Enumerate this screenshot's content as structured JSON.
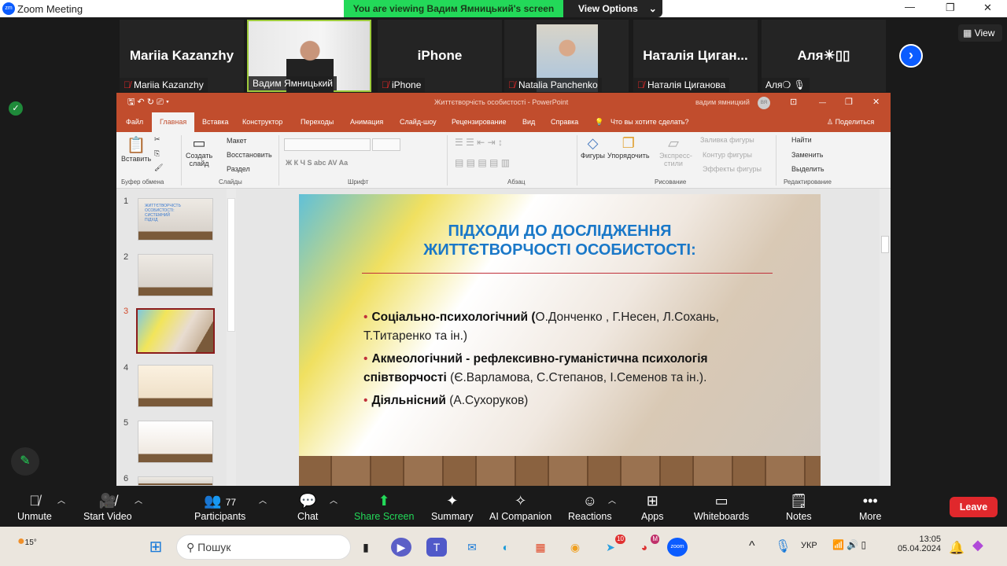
{
  "window": {
    "title": "Zoom Meeting",
    "logo": "zm"
  },
  "banner": {
    "text": "You are viewing Вадим Ямницький's screen",
    "view_options": "View Options"
  },
  "participants": [
    {
      "display": "Mariia Kazanzhy",
      "label": "Mariia Kazanzhy",
      "muted": true
    },
    {
      "display": "",
      "label": "Вадим Ямницький",
      "muted": false,
      "video": true
    },
    {
      "display": "iPhone",
      "label": "iPhone",
      "muted": true
    },
    {
      "display": "",
      "label": "Natalia Panchenko",
      "muted": true,
      "video": true
    },
    {
      "display": "Наталія  Циган...",
      "label": "Наталія Циганова",
      "muted": true
    },
    {
      "display": "Аля☀▯▯",
      "label": "Аля❍ 🎙",
      "muted": false
    }
  ],
  "view_button": "View",
  "ppt": {
    "title": "Життєтворчість особистості  -  PowerPoint",
    "user": "вадим ямницкий",
    "avatar": "ВЯ",
    "tabs": [
      "Файл",
      "Главная",
      "Вставка",
      "Конструктор",
      "Переходы",
      "Анимация",
      "Слайд-шоу",
      "Рецензирование",
      "Вид",
      "Справка"
    ],
    "active_tab": "Главная",
    "tell_me": "Что вы хотите сделать?",
    "share": "Поделиться",
    "ribbon": {
      "paste": "Вставить",
      "new_slide": "Создать слайд",
      "layout": "Макет",
      "reset": "Восстановить",
      "section": "Раздел",
      "shapes": "Фигуры",
      "arrange": "Упорядочить",
      "quick_styles": "Экспресс-стили",
      "fill": "Заливка фигуры",
      "outline": "Контур фигуры",
      "effects": "Эффекты фигуры",
      "find": "Найти",
      "replace": "Заменить",
      "select": "Выделить",
      "font_buttons": "Ж  К  Ч  S  abc  AV  Aa",
      "groups": [
        "Буфер обмена",
        "Слайды",
        "Шрифт",
        "Абзац",
        "Рисование",
        "Редактирование"
      ]
    },
    "thumbnails": [
      {
        "n": "1",
        "title": "ЖИТТЄТВОРЧІСТЬ ОСОБИСТОСТІ: СИСТЕМНИЙ ПІДХІД"
      },
      {
        "n": "2"
      },
      {
        "n": "3",
        "selected": true
      },
      {
        "n": "4"
      },
      {
        "n": "5"
      },
      {
        "n": "6"
      }
    ],
    "slide": {
      "title_line1": "ПІДХОДИ ДО ДОСЛІДЖЕННЯ",
      "title_line2": "ЖИТТЄТВОРЧОСТІ ОСОБИСТОСТІ:",
      "bullets": [
        {
          "bold": "Соціально-психологічний (",
          "rest": "О.Донченко , Г.Несен, Л.Сохань, Т.Титаренко  та ін.)"
        },
        {
          "bold": "Акмеологічний - рефлексивно-гуманістична психологія співтворчості",
          "rest": " (Є.Варламова, С.Степанов, І.Семенов та ін.)."
        },
        {
          "bold": "Діяльнісний",
          "rest": " (А.Сухоруков)"
        }
      ]
    }
  },
  "toolbar": {
    "items": [
      {
        "label": "Unmute",
        "icon": "mic-off-icon"
      },
      {
        "label": "Start Video",
        "icon": "video-off-icon"
      },
      {
        "label": "Participants",
        "icon": "participants-icon",
        "count": "77"
      },
      {
        "label": "Chat",
        "icon": "chat-icon"
      },
      {
        "label": "Share Screen",
        "icon": "share-screen-icon"
      },
      {
        "label": "Summary",
        "icon": "summary-icon"
      },
      {
        "label": "AI Companion",
        "icon": "ai-companion-icon"
      },
      {
        "label": "Reactions",
        "icon": "reactions-icon"
      },
      {
        "label": "Apps",
        "icon": "apps-icon"
      },
      {
        "label": "Whiteboards",
        "icon": "whiteboard-icon"
      },
      {
        "label": "Notes",
        "icon": "notes-icon"
      },
      {
        "label": "More",
        "icon": "more-icon"
      }
    ],
    "leave": "Leave"
  },
  "taskbar": {
    "weather": "15°",
    "search_placeholder": "Пошук",
    "lang": "УКР",
    "time": "13:05",
    "date": "05.04.2024",
    "telegram_badge": "10",
    "chrome_badge": "M"
  },
  "colors": {
    "ppt_red": "#c14d2d",
    "zoom_green": "#23d959",
    "leave_red": "#e0282c",
    "slide_title": "#1a78c8"
  }
}
